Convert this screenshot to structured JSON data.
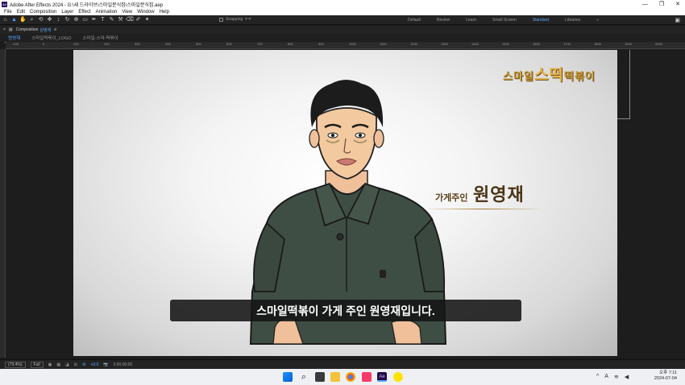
{
  "window": {
    "title": "Adobe After Effects 2024 - G:\\새 드라이브\\스마일분식집\\스마일분식집.aep",
    "app_badge": "Ae",
    "controls": [
      "—",
      "❐",
      "✕"
    ]
  },
  "menu": [
    "File",
    "Edit",
    "Composition",
    "Layer",
    "Effect",
    "Animation",
    "View",
    "Window",
    "Help"
  ],
  "toolbar": {
    "snapping_label": "Snapping",
    "workspaces": [
      "Default",
      "Review",
      "Learn",
      "Small Screen",
      "Standard",
      "Libraries"
    ],
    "active_workspace": "Standard",
    "more": "»"
  },
  "panel": {
    "label": "Composition",
    "comp_name": "원영재",
    "menu_icon": "≡"
  },
  "comp_tabs": [
    "원영재",
    "스마일떡볶이_LOGO",
    "스마일-스마-떡볶이"
  ],
  "ruler_ticks": [
    "-100",
    "0",
    "100",
    "200",
    "300",
    "400",
    "500",
    "600",
    "700",
    "800",
    "900",
    "1000",
    "1100",
    "1200",
    "1300",
    "1400",
    "1500",
    "1600",
    "1700",
    "1800",
    "1900",
    "2000"
  ],
  "frame": {
    "logo_prefix": "스마일",
    "logo_big": "스떡",
    "logo_suffix": "떡볶이",
    "name_role": "가게주인",
    "name_main": "원영재",
    "subtitle": "스마일떡볶이 가게 주인 원영재입니다."
  },
  "statusbar": {
    "zoom": "(79.4%)",
    "resolution": "Full",
    "exposure": "+0.0",
    "timecode": "0;00;00;00"
  },
  "taskbar": {
    "time": "오후 7:11",
    "date": "2024-07-04",
    "lang": "A"
  },
  "colors": {
    "accent": "#5aa7ff",
    "shirt": "#3f4e44",
    "skin": "#f3c9a0",
    "hair": "#1c1c1c",
    "gold": "#c69b3c"
  }
}
